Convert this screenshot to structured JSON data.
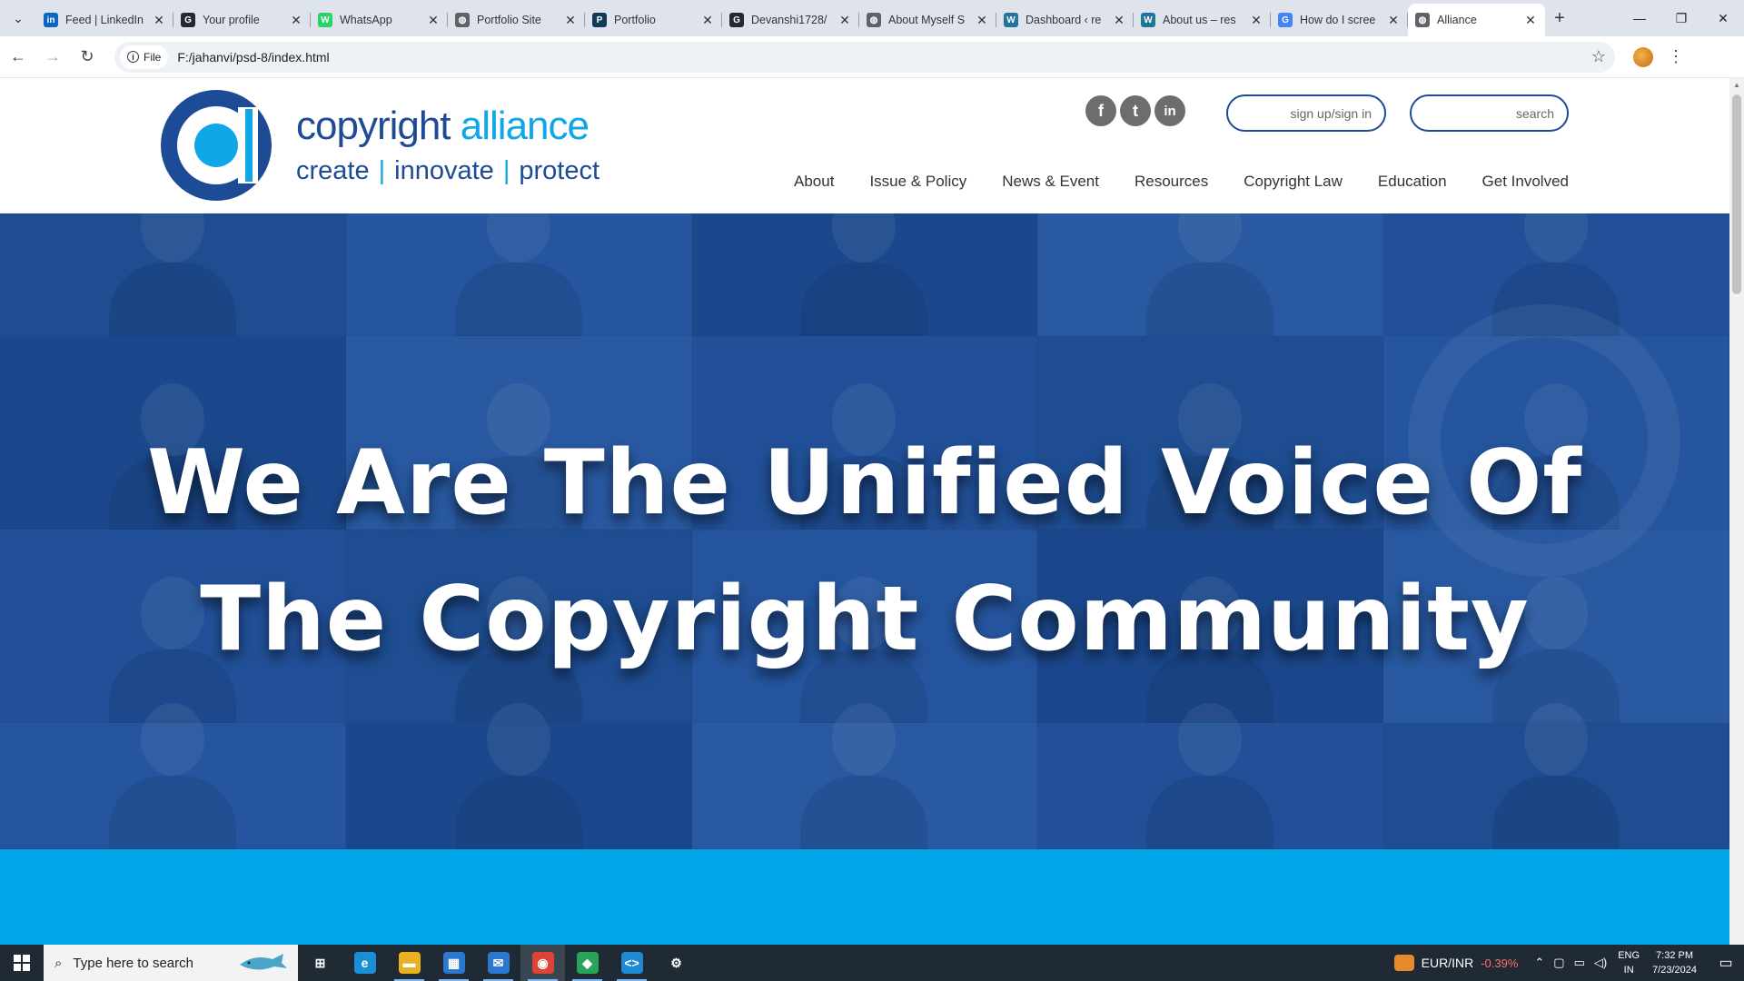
{
  "browser": {
    "tabs": [
      {
        "title": "Feed | LinkedIn",
        "icon": "linkedin-icon",
        "color": "#0a66c2",
        "glyph": "in"
      },
      {
        "title": "Your profile",
        "icon": "github-icon",
        "color": "#24292f",
        "glyph": "G"
      },
      {
        "title": "WhatsApp",
        "icon": "whatsapp-icon",
        "color": "#25d366",
        "glyph": "W"
      },
      {
        "title": "Portfolio Site",
        "icon": "globe-icon",
        "color": "#5f6368",
        "glyph": "◍"
      },
      {
        "title": "Portfolio",
        "icon": "portfolio-icon",
        "color": "#0f3b57",
        "glyph": "P"
      },
      {
        "title": "Devanshi1728/",
        "icon": "github-icon",
        "color": "#24292f",
        "glyph": "G"
      },
      {
        "title": "About Myself S",
        "icon": "globe-icon",
        "color": "#5f6368",
        "glyph": "◍"
      },
      {
        "title": "Dashboard ‹ re",
        "icon": "wordpress-icon",
        "color": "#21759b",
        "glyph": "W"
      },
      {
        "title": "About us – res",
        "icon": "wordpress-icon",
        "color": "#21759b",
        "glyph": "W"
      },
      {
        "title": "How do I scree",
        "icon": "google-icon",
        "color": "#4285f4",
        "glyph": "G"
      },
      {
        "title": "Alliance",
        "icon": "globe-icon",
        "color": "#5f6368",
        "glyph": "◍",
        "active": true
      }
    ],
    "site_chip": "File",
    "url": "F:/jahanvi/psd-8/index.html"
  },
  "site": {
    "brand_main": "copyright ",
    "brand_alt": "alliance",
    "tagline": [
      "create",
      "innovate",
      "protect"
    ],
    "social": [
      {
        "name": "facebook-icon",
        "glyph": "f"
      },
      {
        "name": "twitter-icon",
        "glyph": "t"
      },
      {
        "name": "linkedin-icon",
        "glyph": "in"
      }
    ],
    "signin_placeholder": "sign up/sign in",
    "search_placeholder": "search",
    "nav": [
      "About",
      "Issue & Policy",
      "News & Event",
      "Resources",
      "Copyright Law",
      "Education",
      "Get Involved"
    ],
    "hero_line1": "We Are The Unified Voice Of",
    "hero_line2": "The Copyright Community"
  },
  "colors": {
    "brand_blue": "#1e4b96",
    "brand_cyan": "#10a7e6",
    "hero_blue": "#2a5aa5",
    "band_cyan": "#00a6e8"
  },
  "taskbar": {
    "search_placeholder": "Type here to search",
    "apps": [
      {
        "name": "task-view-icon",
        "glyph": "⊞",
        "color": "transparent"
      },
      {
        "name": "edge-icon",
        "glyph": "e",
        "color": "#1b8fd6"
      },
      {
        "name": "file-explorer-icon",
        "glyph": "▬",
        "color": "#e8b023"
      },
      {
        "name": "store-icon",
        "glyph": "▦",
        "color": "#2b78d0"
      },
      {
        "name": "mail-icon",
        "glyph": "✉",
        "color": "#2b78d0"
      },
      {
        "name": "chrome-icon",
        "glyph": "◉",
        "color": "#db4437",
        "active": true
      },
      {
        "name": "app-icon",
        "glyph": "◆",
        "color": "#27a35b"
      },
      {
        "name": "vscode-icon",
        "glyph": "<>",
        "color": "#1f8ad2"
      },
      {
        "name": "settings-icon",
        "glyph": "⚙",
        "color": "transparent"
      }
    ],
    "ticker_pair": "EUR/INR",
    "ticker_change": "-0.39%",
    "lang_line1": "ENG",
    "lang_line2": "IN",
    "time": "7:32 PM",
    "date": "7/23/2024"
  }
}
